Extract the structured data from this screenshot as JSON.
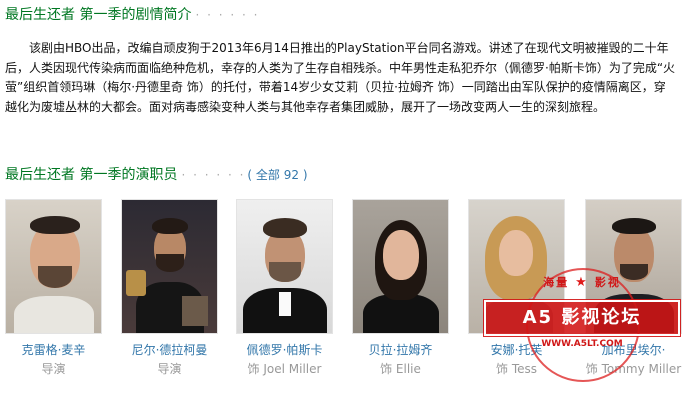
{
  "summary_section": {
    "title": "最后生还者 第一季的剧情简介",
    "dots": "· · · · · ·",
    "text": "该剧由HBO出品，改编自顽皮狗于2013年6月14日推出的PlayStation平台同名游戏。讲述了在现代文明被摧毁的二十年后，人类因现代传染病而面临绝种危机，幸存的人类为了生存自相残杀。中年男性走私犯乔尔（佩德罗·帕斯卡饰）为了完成“火萤”组织首领玛琳（梅尔·丹德里奇 饰）的托付，带着14岁少女艾莉（贝拉·拉姆齐 饰）一同踏出由军队保护的疫情隔离区，穿越化为废墟丛林的大都会。面对病毒感染变种人类与其他幸存者集团威胁，展开了一场改变两人一生的深刻旅程。"
  },
  "cast_section": {
    "title": "最后生还者 第一季的演职员",
    "dots": "· · · · · ·",
    "all_label": "( 全部 92 )"
  },
  "cast": [
    {
      "name": "克雷格·麦辛",
      "role": "导演"
    },
    {
      "name": "尼尔·德拉柯曼",
      "role": "导演"
    },
    {
      "name": "佩德罗·帕斯卡",
      "role": "饰 Joel Miller"
    },
    {
      "name": "贝拉·拉姆齐",
      "role": "饰 Ellie"
    },
    {
      "name": "安娜·托芙",
      "role": "饰 Tess"
    },
    {
      "name": "加布里埃尔·",
      "role": "饰 Tommy Miller"
    }
  ],
  "watermark": {
    "top_left": "海量",
    "top_right": "影视",
    "main": "A5 影视论坛",
    "url": "WWW.A5LT.COM"
  },
  "colors": {
    "title_green": "#007722",
    "link_blue": "#3377aa",
    "muted_gray": "#999999",
    "watermark_red": "#d01818"
  }
}
